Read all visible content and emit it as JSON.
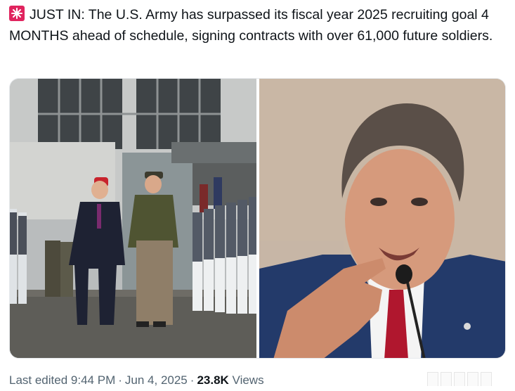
{
  "tweet": {
    "icon": "siren-alert-icon",
    "text": "JUST IN: The U.S. Army has surpassed its fiscal year 2025 recruiting goal 4 MONTHS ahead of schedule, signing contracts with over 61,000 future soldiers."
  },
  "meta": {
    "edited_label": "Last edited",
    "time": "9:44 PM",
    "separator": "·",
    "date": "Jun 4, 2025",
    "views_count": "23.8K",
    "views_label": "Views"
  },
  "colors": {
    "text_primary": "#0f1419",
    "text_secondary": "#536471",
    "alert_icon": "#e0245e"
  }
}
